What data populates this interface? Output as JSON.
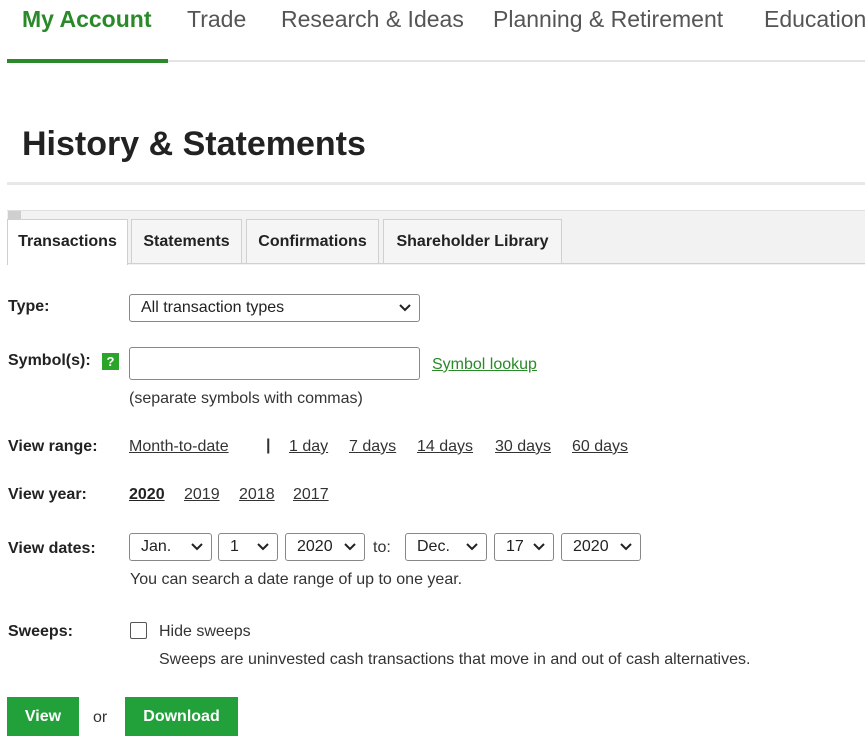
{
  "topnav": {
    "items": [
      {
        "label": "My Account",
        "active": true
      },
      {
        "label": "Trade"
      },
      {
        "label": "Research & Ideas"
      },
      {
        "label": "Planning & Retirement"
      },
      {
        "label": "Education"
      }
    ],
    "accent_color": "#2a8a2a"
  },
  "page": {
    "title": "History & Statements"
  },
  "tabs": [
    {
      "label": "Transactions",
      "active": true
    },
    {
      "label": "Statements"
    },
    {
      "label": "Confirmations"
    },
    {
      "label": "Shareholder Library"
    }
  ],
  "form": {
    "type": {
      "label": "Type:",
      "value": "All transaction types"
    },
    "symbols": {
      "label": "Symbol(s):",
      "help": "?",
      "value": "",
      "lookup_link": "Symbol lookup",
      "hint": "(separate symbols with commas)"
    },
    "view_range": {
      "label": "View range:",
      "options": [
        "Month-to-date",
        "1 day",
        "7 days",
        "14 days",
        "30 days",
        "60 days"
      ],
      "separator": "|"
    },
    "view_year": {
      "label": "View year:",
      "options": [
        "2020",
        "2019",
        "2018",
        "2017"
      ],
      "selected": "2020"
    },
    "view_dates": {
      "label": "View dates:",
      "from_month": "Jan.",
      "from_day": "1",
      "from_year": "2020",
      "to_label": "to:",
      "to_month": "Dec.",
      "to_day": "17",
      "to_year": "2020",
      "hint": "You can search a date range of up to one year."
    },
    "sweeps": {
      "label": "Sweeps:",
      "checkbox_label": "Hide sweeps",
      "checked": false,
      "hint": "Sweeps are uninvested cash transactions that move in and out of cash alternatives."
    }
  },
  "actions": {
    "view_label": "View",
    "or_label": "or",
    "download_label": "Download",
    "button_color": "#22a13a"
  }
}
